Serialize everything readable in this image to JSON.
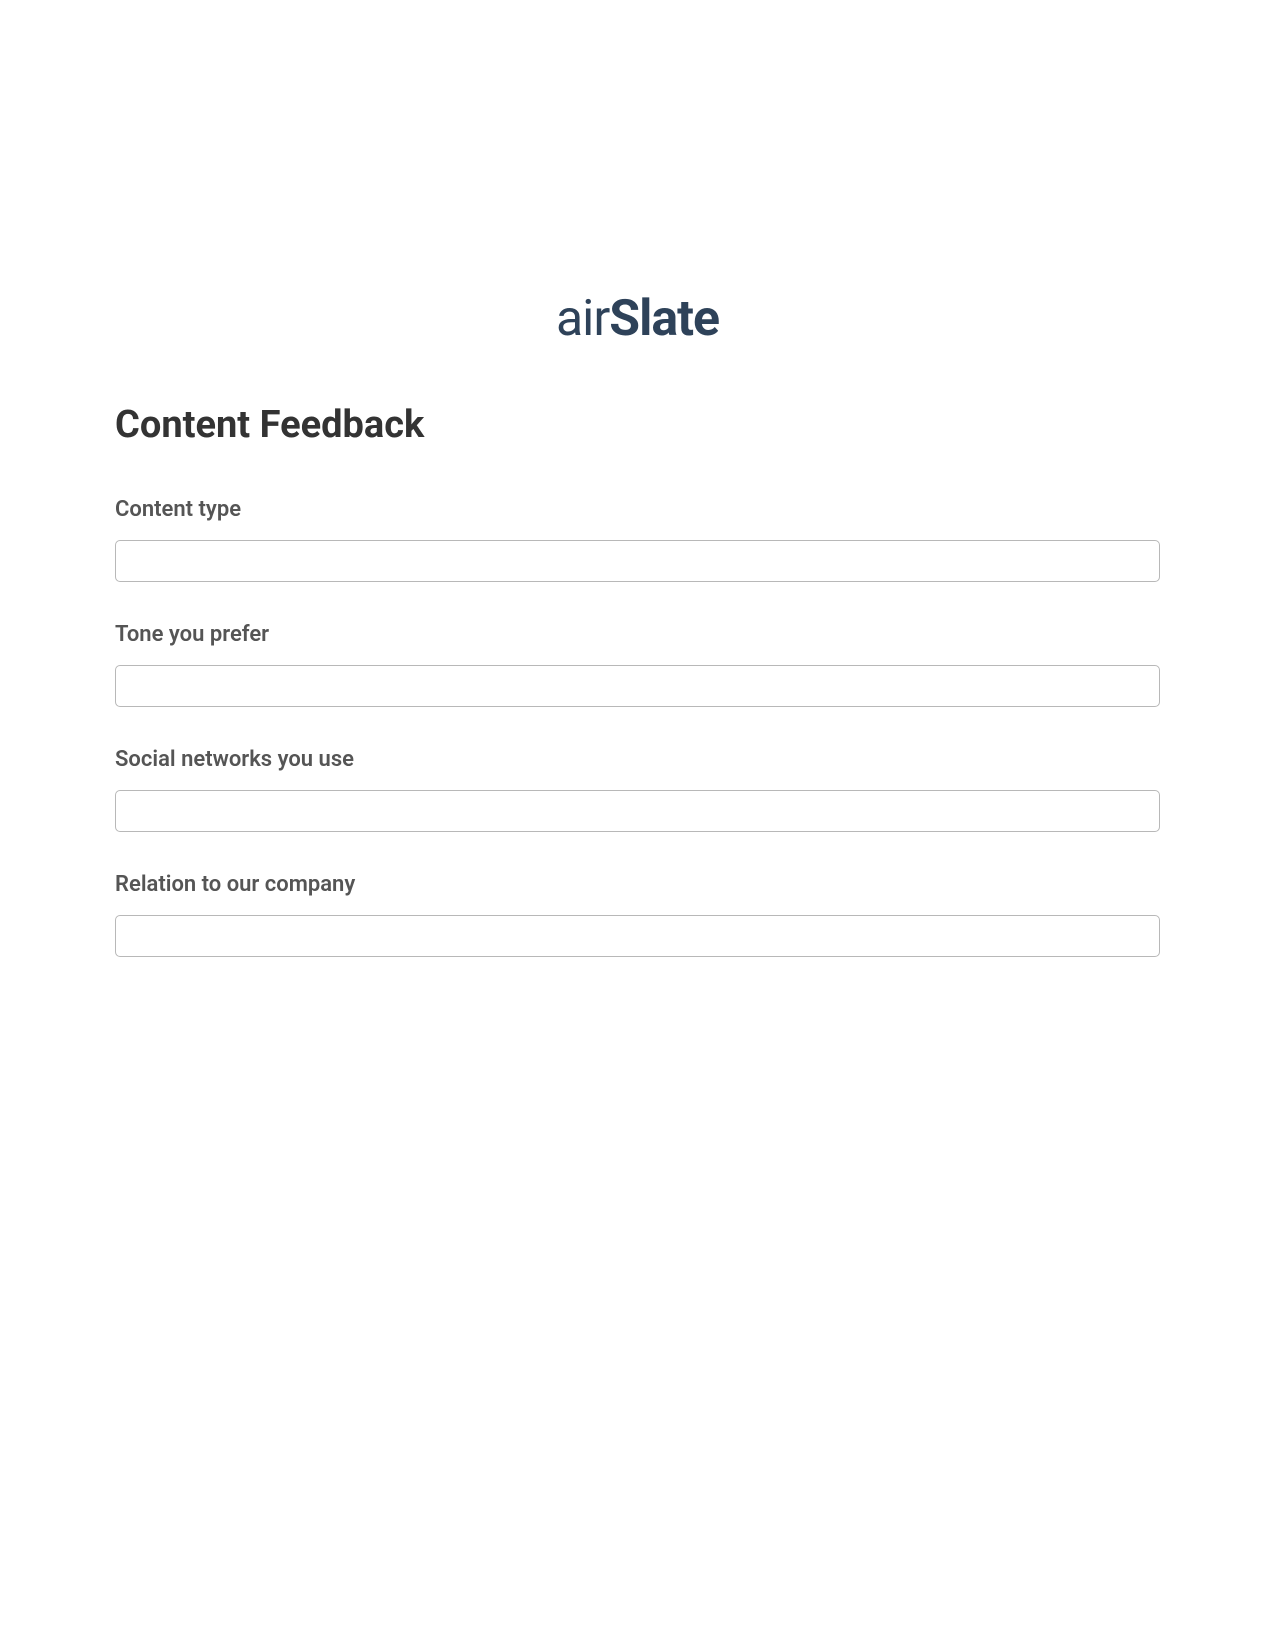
{
  "logo": {
    "prefix": "air",
    "suffix": "Slate"
  },
  "form": {
    "title": "Content Feedback",
    "fields": [
      {
        "label": "Content type",
        "value": ""
      },
      {
        "label": "Tone you prefer",
        "value": ""
      },
      {
        "label": "Social networks you use",
        "value": ""
      },
      {
        "label": "Relation to our company",
        "value": ""
      }
    ]
  }
}
